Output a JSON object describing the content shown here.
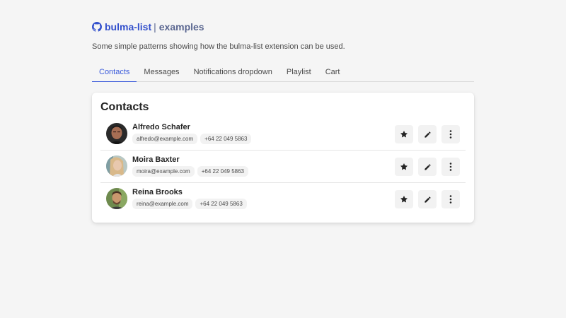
{
  "header": {
    "repo_name": "bulma-list",
    "separator": "|",
    "section": "examples",
    "description": "Some simple patterns showing how the bulma-list extension can be used."
  },
  "tabs": [
    {
      "label": "Contacts",
      "active": true
    },
    {
      "label": "Messages",
      "active": false
    },
    {
      "label": "Notifications dropdown",
      "active": false
    },
    {
      "label": "Playlist",
      "active": false
    },
    {
      "label": "Cart",
      "active": false
    }
  ],
  "card": {
    "title": "Contacts",
    "contacts": [
      {
        "name": "Alfredo Schafer",
        "email": "alfredo@example.com",
        "phone": "+64 22 049 5863"
      },
      {
        "name": "Moira Baxter",
        "email": "moira@example.com",
        "phone": "+64 22 049 5863"
      },
      {
        "name": "Reina Brooks",
        "email": "reina@example.com",
        "phone": "+64 22 049 5863"
      }
    ],
    "actions": [
      "star-icon",
      "pencil-icon",
      "more-vertical-icon"
    ]
  },
  "colors": {
    "accent": "#3b5bdb",
    "brand": "#3350cc",
    "background": "#f5f5f5"
  }
}
